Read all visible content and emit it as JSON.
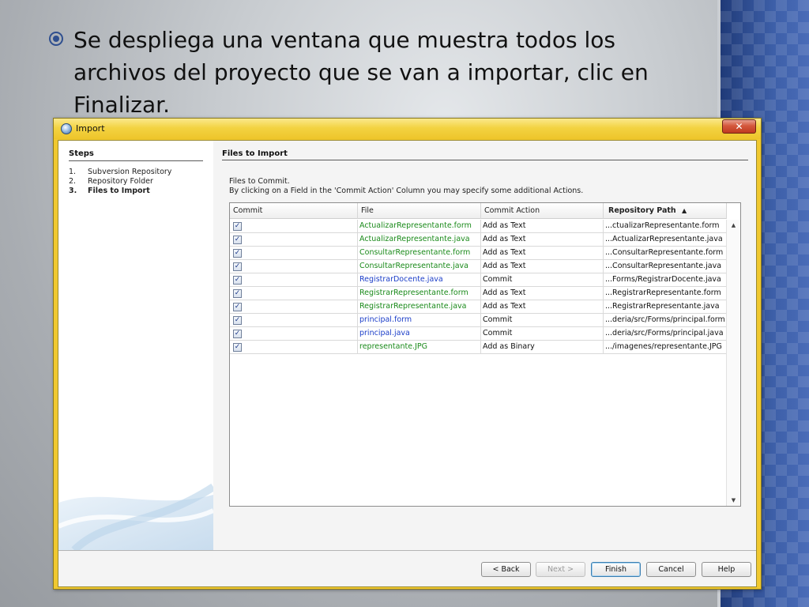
{
  "slide": {
    "bullet_text": "Se despliega una ventana que muestra todos los archivos del proyecto que se van a importar, clic en Finalizar."
  },
  "dialog": {
    "title": "Import",
    "close_glyph": "✕",
    "steps": {
      "title": "Steps",
      "items": [
        {
          "num": "1.",
          "label": "Subversion Repository",
          "current": false
        },
        {
          "num": "2.",
          "label": "Repository Folder",
          "current": false
        },
        {
          "num": "3.",
          "label": "Files to Import",
          "current": true
        }
      ]
    },
    "content": {
      "title": "Files to Import",
      "line1": "Files to Commit.",
      "line2": "By clicking on a Field in the 'Commit Action' Column you may specify some additional Actions."
    },
    "table": {
      "headers": {
        "commit": "Commit",
        "file": "File",
        "action": "Commit Action",
        "path": "Repository Path",
        "sort_indicator": "▲"
      },
      "rows": [
        {
          "checked": true,
          "file": "ActualizarRepresentante.form",
          "action": "Add as Text",
          "path": "...ctualizarRepresentante.form",
          "color": "#1a8a1a"
        },
        {
          "checked": true,
          "file": "ActualizarRepresentante.java",
          "action": "Add as Text",
          "path": "...ActualizarRepresentante.java",
          "color": "#1a8a1a"
        },
        {
          "checked": true,
          "file": "ConsultarRepresentante.form",
          "action": "Add as Text",
          "path": "...ConsultarRepresentante.form",
          "color": "#1a8a1a"
        },
        {
          "checked": true,
          "file": "ConsultarRepresentante.java",
          "action": "Add as Text",
          "path": "...ConsultarRepresentante.java",
          "color": "#1a8a1a"
        },
        {
          "checked": true,
          "file": "RegistrarDocente.java",
          "action": "Commit",
          "path": "...Forms/RegistrarDocente.java",
          "color": "#1c3ec8"
        },
        {
          "checked": true,
          "file": "RegistrarRepresentante.form",
          "action": "Add as Text",
          "path": "...RegistrarRepresentante.form",
          "color": "#1a8a1a"
        },
        {
          "checked": true,
          "file": "RegistrarRepresentante.java",
          "action": "Add as Text",
          "path": "...RegistrarRepresentante.java",
          "color": "#1a8a1a"
        },
        {
          "checked": true,
          "file": "principal.form",
          "action": "Commit",
          "path": "...deria/src/Forms/principal.form",
          "color": "#1c3ec8"
        },
        {
          "checked": true,
          "file": "principal.java",
          "action": "Commit",
          "path": "...deria/src/Forms/principal.java",
          "color": "#1c3ec8"
        },
        {
          "checked": true,
          "file": "representante.JPG",
          "action": "Add as Binary",
          "path": ".../imagenes/representante.JPG",
          "color": "#1a8a1a"
        }
      ]
    },
    "buttons": {
      "back": "< Back",
      "next": "Next >",
      "finish": "Finish",
      "cancel": "Cancel",
      "help": "Help"
    }
  }
}
